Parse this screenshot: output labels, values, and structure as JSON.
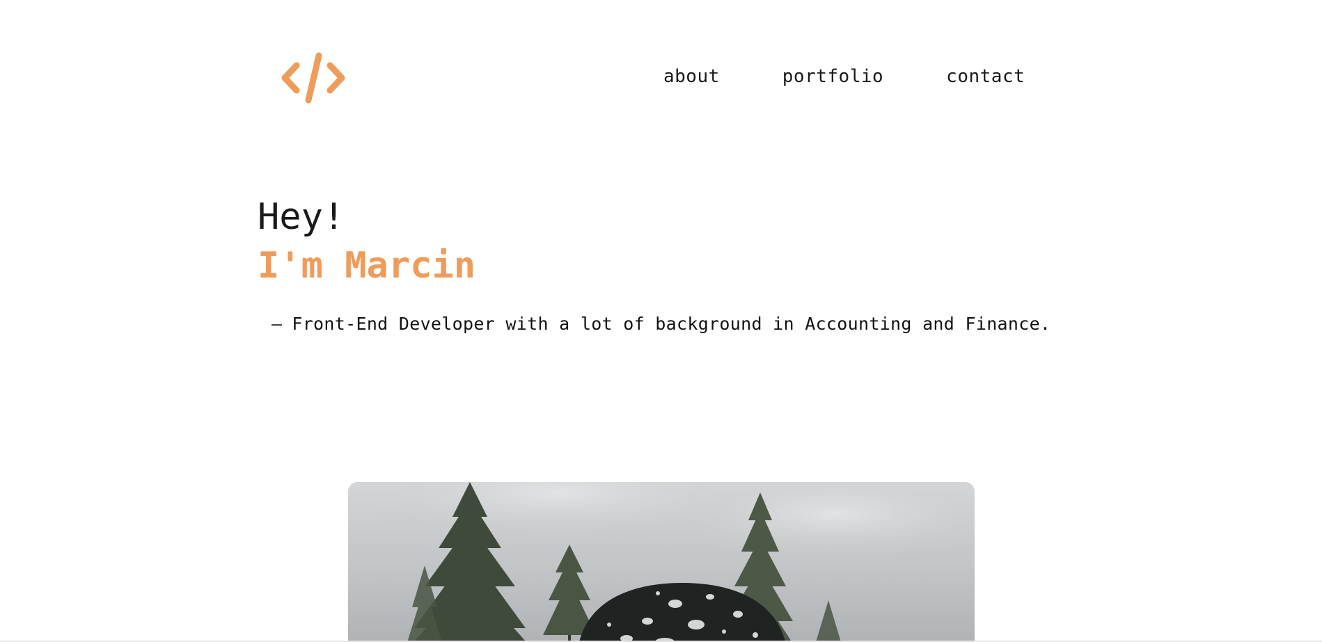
{
  "header": {
    "logo_icon": "code-brackets-icon",
    "logo_color": "#ef9c5b",
    "nav": [
      {
        "label": "about"
      },
      {
        "label": "portfolio"
      },
      {
        "label": "contact"
      }
    ]
  },
  "hero": {
    "greeting": "Hey!",
    "name": "I'm Marcin",
    "tagline_dash": "—",
    "tagline": "Front-End Developer with a lot of background in Accounting and Finance."
  },
  "photo": {
    "subject": "snowy-trees-photo"
  },
  "colors": {
    "accent": "#ef9c5b",
    "text": "#1a1a1a",
    "background": "#ffffff"
  }
}
